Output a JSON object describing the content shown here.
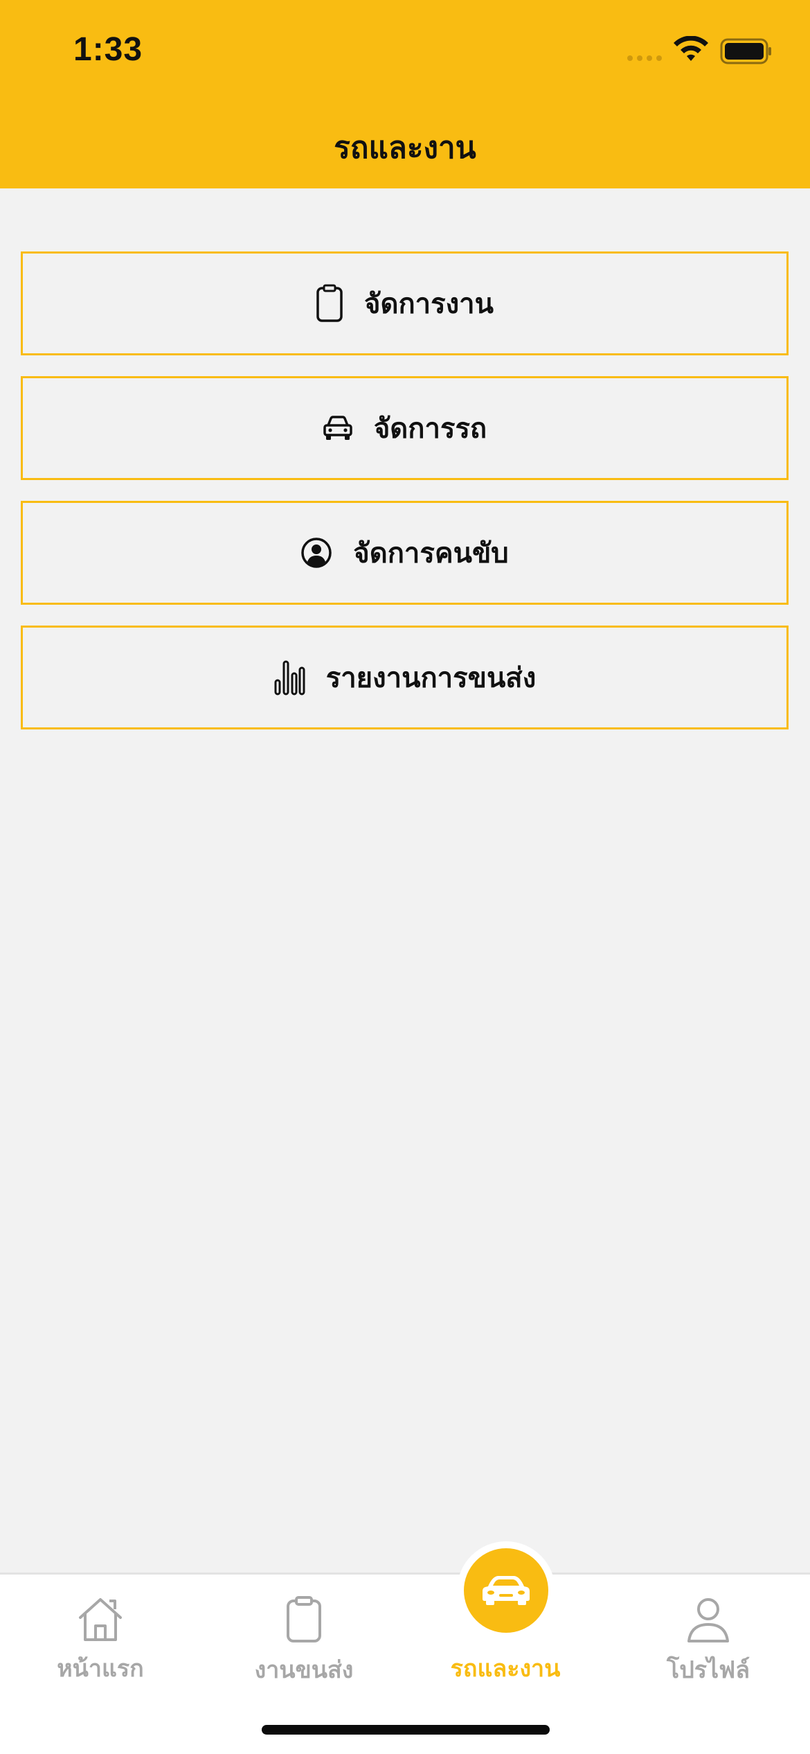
{
  "status_bar": {
    "time": "1:33"
  },
  "header": {
    "title": "รถและงาน"
  },
  "menu": {
    "items": [
      {
        "label": "จัดการงาน",
        "icon": "clipboard-icon"
      },
      {
        "label": "จัดการรถ",
        "icon": "car-icon"
      },
      {
        "label": "จัดการคนขับ",
        "icon": "user-circle-icon"
      },
      {
        "label": "รายงานการขนส่ง",
        "icon": "bar-chart-icon"
      }
    ]
  },
  "tabbar": {
    "tabs": [
      {
        "label": "หน้าแรก",
        "icon": "home-icon",
        "active": false
      },
      {
        "label": "งานขนส่ง",
        "icon": "clipboard-icon",
        "active": false
      },
      {
        "label": "รถและงาน",
        "icon": "car-icon",
        "active": true
      },
      {
        "label": "โปรไฟล์",
        "icon": "user-icon",
        "active": false
      }
    ]
  },
  "colors": {
    "accent": "#f9bc12",
    "background": "#f2f2f2",
    "inactive_tab": "#a7a7a7"
  }
}
